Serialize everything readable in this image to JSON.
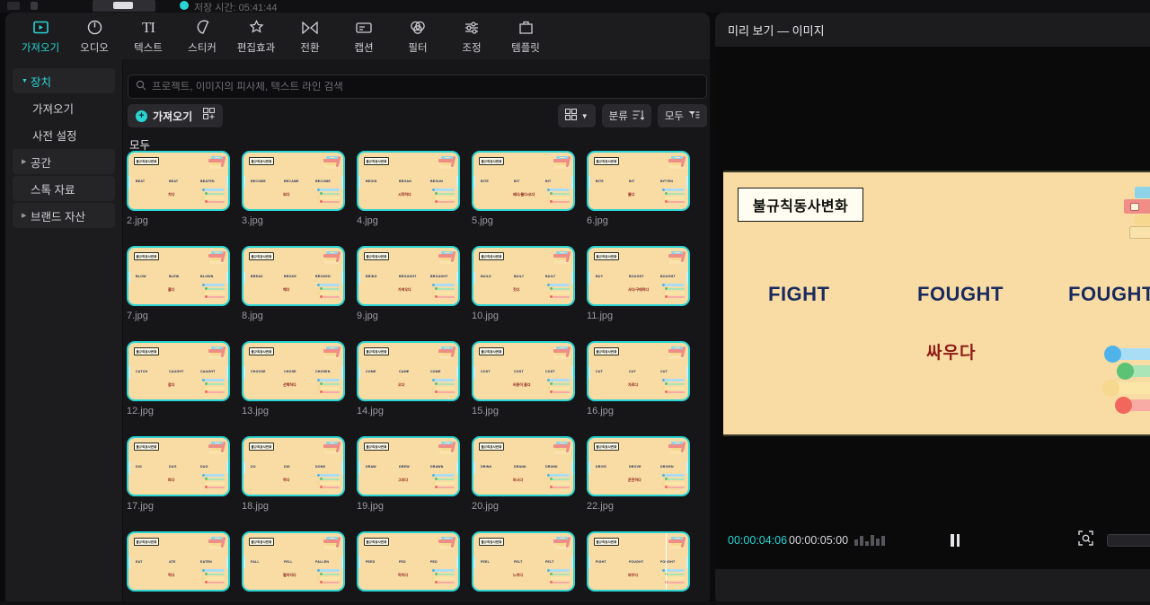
{
  "top_strip": {
    "status_text": "저장 시간: 05:41:44",
    "partial": true
  },
  "tabs": [
    {
      "label": "가져오기",
      "icon": "import-media-icon",
      "active": true
    },
    {
      "label": "오디오",
      "icon": "audio-icon",
      "active": false
    },
    {
      "label": "텍스트",
      "icon": "text-icon",
      "active": false
    },
    {
      "label": "스티커",
      "icon": "sticker-icon",
      "active": false
    },
    {
      "label": "편집효과",
      "icon": "effects-icon",
      "active": false
    },
    {
      "label": "전환",
      "icon": "transition-icon",
      "active": false
    },
    {
      "label": "캡션",
      "icon": "caption-icon",
      "active": false
    },
    {
      "label": "필터",
      "icon": "filter-icon",
      "active": false
    },
    {
      "label": "조정",
      "icon": "adjust-icon",
      "active": false
    },
    {
      "label": "템플릿",
      "icon": "template-icon",
      "active": false
    }
  ],
  "sidebar": {
    "items": [
      {
        "label": "장치",
        "type": "group",
        "expanded": true,
        "selected": true
      },
      {
        "label": "가져오기",
        "type": "child",
        "selected": false
      },
      {
        "label": "사전 설정",
        "type": "child",
        "selected": false
      },
      {
        "label": "공간",
        "type": "group",
        "expanded": false,
        "selected": false
      },
      {
        "label": "스톡 자료",
        "type": "group-noarrow",
        "selected": false
      },
      {
        "label": "브랜드 자산",
        "type": "group",
        "expanded": false,
        "selected": false
      }
    ]
  },
  "search": {
    "placeholder": "프로젝트, 이미지의 피사체, 텍스트 라인 검색",
    "value": "",
    "icon": "search-icon"
  },
  "toolbar": {
    "import_label": "가져오기",
    "import_plus": "+",
    "import_grid_icon": "grid-add-icon",
    "view_icon": "grid-view-icon",
    "view_caret": "chevron-down-icon",
    "sort_label": "분류",
    "sort_icon": "sort-icon",
    "filter_label": "모두",
    "filter_icon": "filter-list-icon"
  },
  "group_caption": "모두",
  "media_grid": {
    "accent_color": "#2ad4d4",
    "slide_bg": "#f8dca4",
    "slide_title": "불규칙동사변화",
    "items": [
      {
        "file": "2.jpg",
        "w1": "BEAT",
        "w2": "BEAT",
        "w3": "BEATEN",
        "kr": "치다"
      },
      {
        "file": "3.jpg",
        "w1": "BECOME",
        "w2": "BECAME",
        "w3": "BECOME",
        "kr": "되다"
      },
      {
        "file": "4.jpg",
        "w1": "BEGIN",
        "w2": "BEGAN",
        "w3": "BEGUN",
        "kr": "시작하다"
      },
      {
        "file": "5.jpg",
        "w1": "BITE",
        "w2": "BIT",
        "w3": "BIT",
        "kr": "베다/물다/쏘다"
      },
      {
        "file": "6.jpg",
        "w1": "BITE",
        "w2": "BIT",
        "w3": "BITTEN",
        "kr": "물다"
      },
      {
        "file": "7.jpg",
        "w1": "BLOW",
        "w2": "BLEW",
        "w3": "BLOWN",
        "kr": "불다"
      },
      {
        "file": "8.jpg",
        "w1": "BREAK",
        "w2": "BROKE",
        "w3": "BROKEN",
        "kr": "깨다"
      },
      {
        "file": "9.jpg",
        "w1": "BRING",
        "w2": "BROUGHT",
        "w3": "BROUGHT",
        "kr": "가져오다"
      },
      {
        "file": "10.jpg",
        "w1": "BUILD",
        "w2": "BUILT",
        "w3": "BUILT",
        "kr": "짓다"
      },
      {
        "file": "11.jpg",
        "w1": "BUY",
        "w2": "BOUGHT",
        "w3": "BOUGHT",
        "kr": "사다/구매하다"
      },
      {
        "file": "12.jpg",
        "w1": "CATCH",
        "w2": "CAUGHT",
        "w3": "CAUGHT",
        "kr": "잡다"
      },
      {
        "file": "13.jpg",
        "w1": "CHOOSE",
        "w2": "CHOSE",
        "w3": "CHOSEN",
        "kr": "선택하다"
      },
      {
        "file": "14.jpg",
        "w1": "COME",
        "w2": "CAME",
        "w3": "COME",
        "kr": "오다"
      },
      {
        "file": "15.jpg",
        "w1": "COST",
        "w2": "COST",
        "w3": "COST",
        "kr": "비용이 들다"
      },
      {
        "file": "16.jpg",
        "w1": "CUT",
        "w2": "CUT",
        "w3": "CUT",
        "kr": "자르다"
      },
      {
        "file": "17.jpg",
        "w1": "DIG",
        "w2": "DUG",
        "w3": "DUG",
        "kr": "파다"
      },
      {
        "file": "18.jpg",
        "w1": "DO",
        "w2": "DID",
        "w3": "DONE",
        "kr": "하다"
      },
      {
        "file": "19.jpg",
        "w1": "DRAW",
        "w2": "DREW",
        "w3": "DRAWN",
        "kr": "그리다"
      },
      {
        "file": "20.jpg",
        "w1": "DRINK",
        "w2": "DRANK",
        "w3": "DRUNK",
        "kr": "마시다"
      },
      {
        "file": "22.jpg",
        "w1": "DRIVE",
        "w2": "DROVE",
        "w3": "DRIVEN",
        "kr": "운전하다"
      },
      {
        "file": "",
        "w1": "EAT",
        "w2": "ATE",
        "w3": "EATEN",
        "kr": "먹다"
      },
      {
        "file": "",
        "w1": "FALL",
        "w2": "FELL",
        "w3": "FALLEN",
        "kr": "떨어지다"
      },
      {
        "file": "",
        "w1": "FEED",
        "w2": "FED",
        "w3": "FED",
        "kr": "먹이다"
      },
      {
        "file": "",
        "w1": "FEEL",
        "w2": "FELT",
        "w3": "FELT",
        "kr": "느끼다"
      },
      {
        "file": "",
        "w1": "FIGHT",
        "w2": "FOUGHT",
        "w3": "FOUGHT",
        "kr": "싸우다"
      }
    ]
  },
  "preview": {
    "title": "미리 보기 — 이미지",
    "slide": {
      "title": "불규칙동사변화",
      "word_past_simple": "FIGHT",
      "word_past": "FOUGHT",
      "word_participle": "FOUGHT",
      "korean": "싸우다",
      "bg_color": "#f8dca4",
      "word_color": "#1b2a5e",
      "korean_color": "#8e1b16"
    },
    "transport": {
      "current_time": "00:00:04:06",
      "total_time": "00:00:05:00",
      "current_color": "#2ad4d4",
      "play_state": "pause",
      "pause_icon": "pause-icon",
      "levels_icon": "audio-levels-icon",
      "fit_icon": "fit-to-screen-icon",
      "zoom_slider": "zoom-slider"
    }
  }
}
